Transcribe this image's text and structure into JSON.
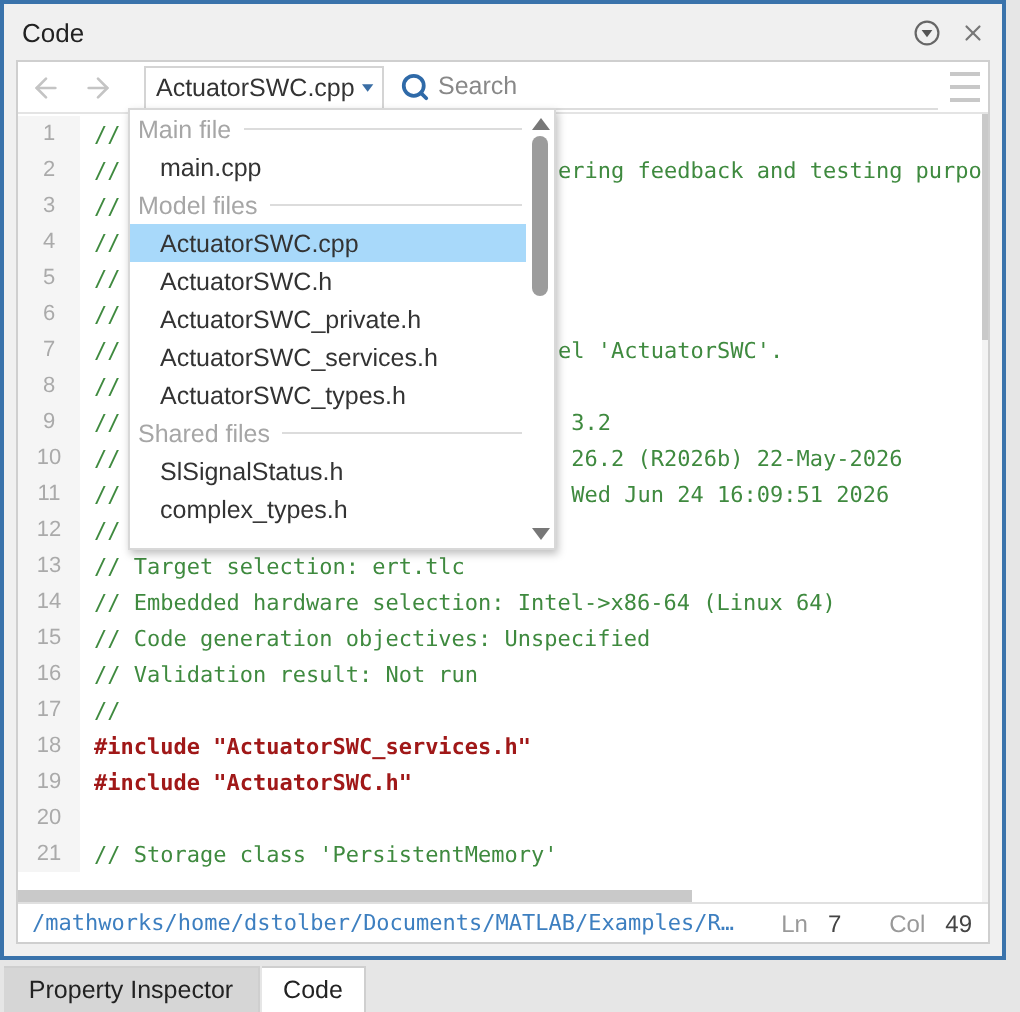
{
  "panel": {
    "title": "Code"
  },
  "toolbar": {
    "file": "ActuatorSWC.cpp",
    "search": {
      "placeholder": "Search"
    }
  },
  "file_menu": [
    {
      "header": "Main file",
      "items": [
        {
          "label": "main.cpp",
          "selected": false
        }
      ]
    },
    {
      "header": "Model files",
      "items": [
        {
          "label": "ActuatorSWC.cpp",
          "selected": true
        },
        {
          "label": "ActuatorSWC.h",
          "selected": false
        },
        {
          "label": "ActuatorSWC_private.h",
          "selected": false
        },
        {
          "label": "ActuatorSWC_services.h",
          "selected": false
        },
        {
          "label": "ActuatorSWC_types.h",
          "selected": false
        }
      ]
    },
    {
      "header": "Shared files",
      "items": [
        {
          "label": "SlSignalStatus.h",
          "selected": false
        },
        {
          "label": "complex_types.h",
          "selected": false
        }
      ]
    }
  ],
  "code_lines": [
    {
      "number": "1",
      "kind": "comment",
      "text": "//"
    },
    {
      "number": "2",
      "kind": "comment",
      "text": "//",
      "tail": "ering feedback and testing purpo"
    },
    {
      "number": "3",
      "kind": "comment",
      "text": "//"
    },
    {
      "number": "4",
      "kind": "comment",
      "text": "//"
    },
    {
      "number": "5",
      "kind": "comment",
      "text": "//"
    },
    {
      "number": "6",
      "kind": "comment",
      "text": "//"
    },
    {
      "number": "7",
      "kind": "comment",
      "text": "//",
      "tail": "el 'ActuatorSWC'."
    },
    {
      "number": "8",
      "kind": "comment",
      "text": "//"
    },
    {
      "number": "9",
      "kind": "comment",
      "text": "//",
      "tail": " 3.2"
    },
    {
      "number": "10",
      "kind": "comment",
      "text": "//",
      "tail": " 26.2 (R2026b) 22-May-2026"
    },
    {
      "number": "11",
      "kind": "comment",
      "text": "//",
      "tail": " Wed Jun 24 16:09:51 2026"
    },
    {
      "number": "12",
      "kind": "comment",
      "text": "//"
    },
    {
      "number": "13",
      "kind": "comment",
      "text": "// Target selection: ert.tlc"
    },
    {
      "number": "14",
      "kind": "comment",
      "text": "// Embedded hardware selection: Intel->x86-64 (Linux 64)"
    },
    {
      "number": "15",
      "kind": "comment",
      "text": "// Code generation objectives: Unspecified"
    },
    {
      "number": "16",
      "kind": "comment",
      "text": "// Validation result: Not run"
    },
    {
      "number": "17",
      "kind": "comment",
      "text": "//"
    },
    {
      "number": "18",
      "kind": "include",
      "text": "#include \"ActuatorSWC_services.h\""
    },
    {
      "number": "19",
      "kind": "include",
      "text": "#include \"ActuatorSWC.h\""
    },
    {
      "number": "20",
      "kind": "blank"
    },
    {
      "number": "21",
      "kind": "comment",
      "text": "// Storage class 'PersistentMemory'"
    }
  ],
  "status_bar": {
    "path": "/mathworks/home/dstolber/Documents/MATLAB/Examples/R…",
    "line_label": "Ln",
    "line": "7",
    "col_label": "Col",
    "col": "49"
  },
  "tabs": [
    {
      "label": "Property Inspector",
      "selected": false
    },
    {
      "label": "Code",
      "selected": true
    }
  ]
}
